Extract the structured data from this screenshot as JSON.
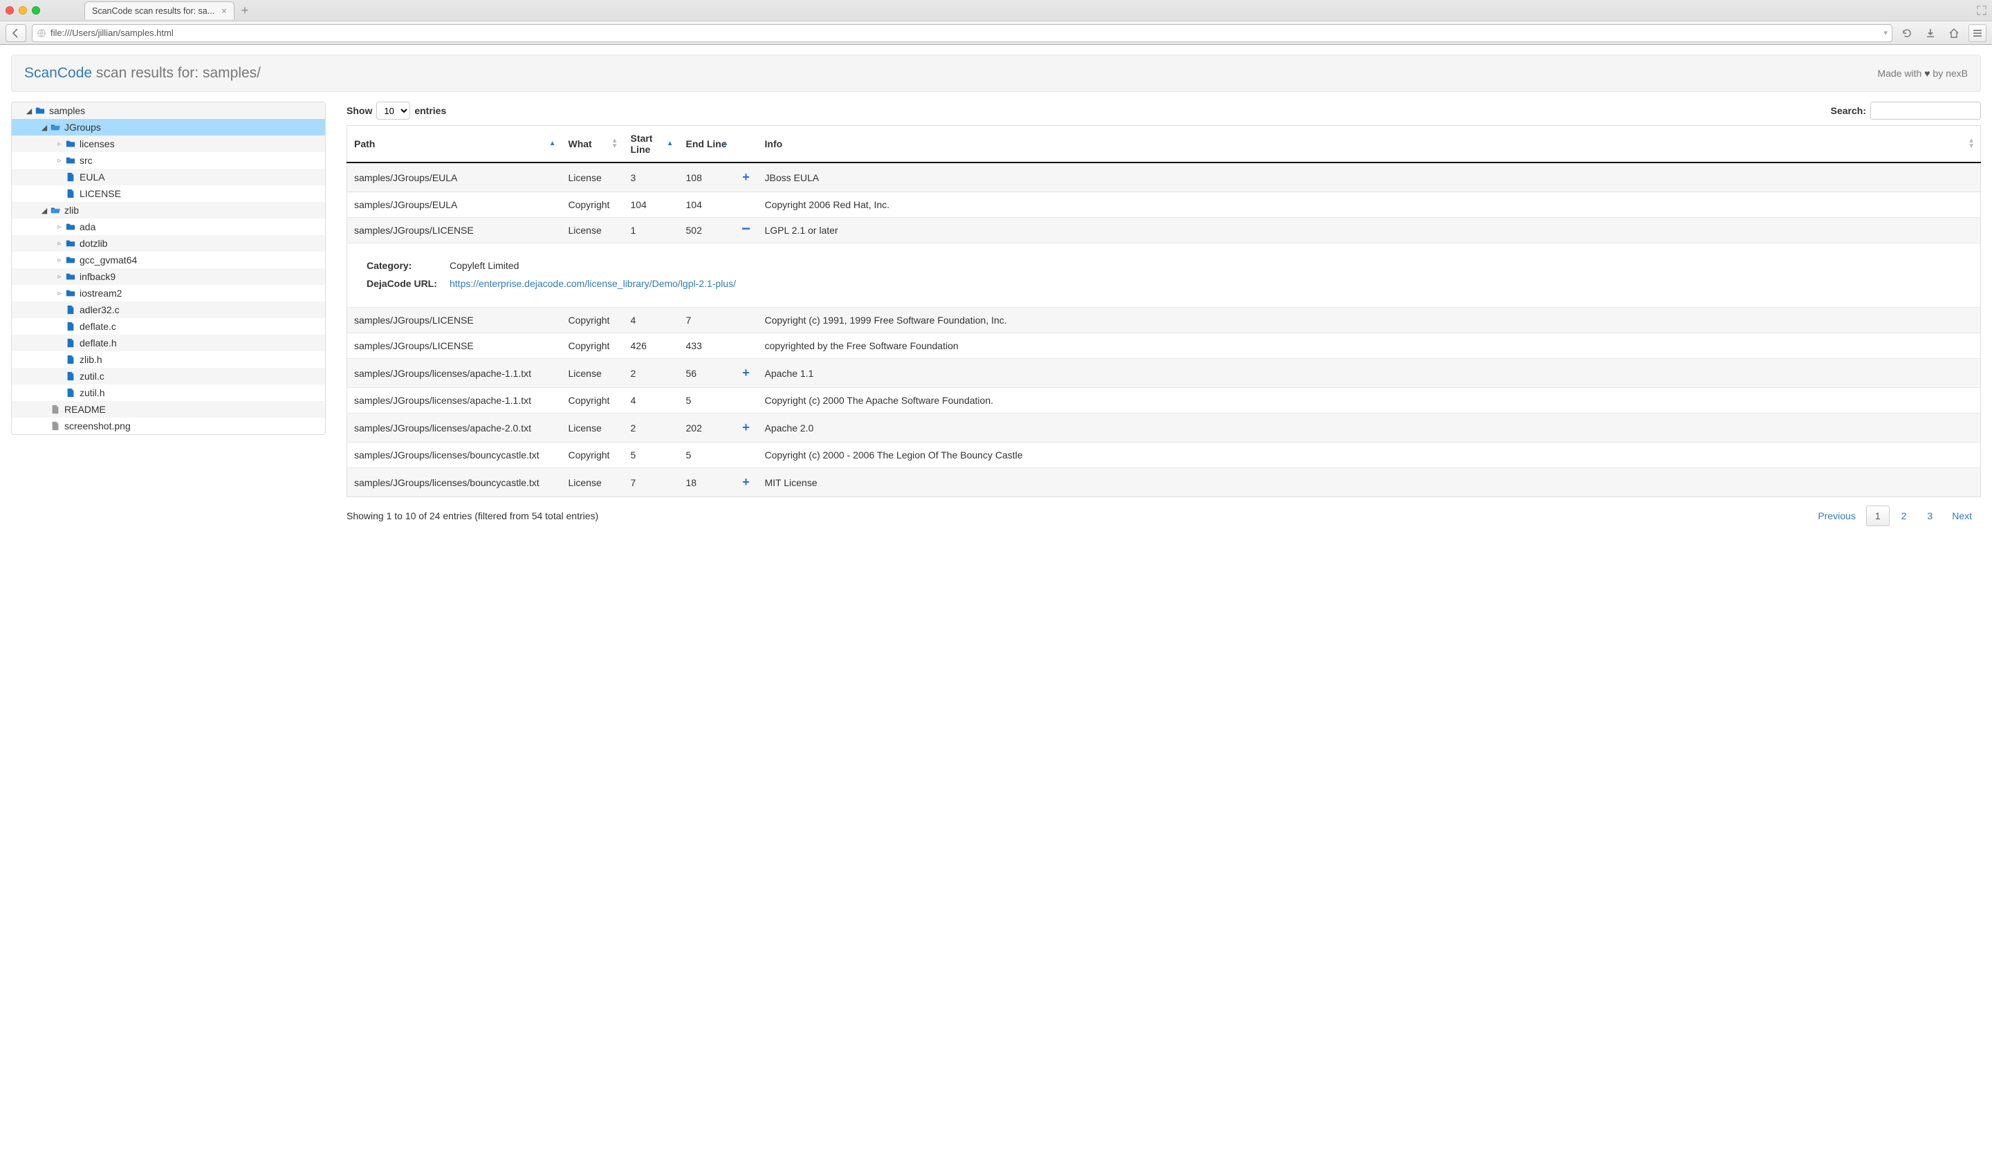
{
  "browser": {
    "tab_title": "ScanCode scan results for: sa...",
    "url": "file:///Users/jillian/samples.html"
  },
  "header": {
    "brand": "ScanCode",
    "title_rest": " scan results for: samples/",
    "made_with_prefix": "Made with ",
    "made_with_suffix": " by nexB",
    "heart": "♥"
  },
  "tree": [
    {
      "depth": 0,
      "toggle": "down",
      "icon": "folder",
      "label": "samples"
    },
    {
      "depth": 1,
      "toggle": "down",
      "icon": "folder-open",
      "label": "JGroups",
      "selected": true
    },
    {
      "depth": 2,
      "toggle": "right",
      "icon": "folder",
      "label": "licenses"
    },
    {
      "depth": 2,
      "toggle": "right",
      "icon": "folder",
      "label": "src"
    },
    {
      "depth": 2,
      "toggle": "none",
      "icon": "file",
      "label": "EULA"
    },
    {
      "depth": 2,
      "toggle": "none",
      "icon": "file",
      "label": "LICENSE"
    },
    {
      "depth": 1,
      "toggle": "down",
      "icon": "folder-open",
      "label": "zlib"
    },
    {
      "depth": 2,
      "toggle": "right",
      "icon": "folder",
      "label": "ada"
    },
    {
      "depth": 2,
      "toggle": "right",
      "icon": "folder",
      "label": "dotzlib"
    },
    {
      "depth": 2,
      "toggle": "right",
      "icon": "folder",
      "label": "gcc_gvmat64"
    },
    {
      "depth": 2,
      "toggle": "right",
      "icon": "folder",
      "label": "infback9"
    },
    {
      "depth": 2,
      "toggle": "right",
      "icon": "folder",
      "label": "iostream2"
    },
    {
      "depth": 2,
      "toggle": "none",
      "icon": "file",
      "label": "adler32.c"
    },
    {
      "depth": 2,
      "toggle": "none",
      "icon": "file",
      "label": "deflate.c"
    },
    {
      "depth": 2,
      "toggle": "none",
      "icon": "file",
      "label": "deflate.h"
    },
    {
      "depth": 2,
      "toggle": "none",
      "icon": "file",
      "label": "zlib.h"
    },
    {
      "depth": 2,
      "toggle": "none",
      "icon": "file",
      "label": "zutil.c"
    },
    {
      "depth": 2,
      "toggle": "none",
      "icon": "file",
      "label": "zutil.h"
    },
    {
      "depth": 1,
      "toggle": "none",
      "icon": "file-grey",
      "label": "README"
    },
    {
      "depth": 1,
      "toggle": "none",
      "icon": "file-grey",
      "label": "screenshot.png"
    }
  ],
  "table_controls": {
    "show_label": "Show",
    "entries_label": "entries",
    "page_size": "10",
    "search_label": "Search:",
    "search_value": ""
  },
  "columns": {
    "path": "Path",
    "what": "What",
    "start": "Start Line",
    "end": "End Line",
    "expand": "",
    "info": "Info"
  },
  "rows": [
    {
      "path": "samples/JGroups/EULA",
      "what": "License",
      "start": "3",
      "end": "108",
      "exp": "plus",
      "info": "JBoss EULA"
    },
    {
      "path": "samples/JGroups/EULA",
      "what": "Copyright",
      "start": "104",
      "end": "104",
      "exp": "",
      "info": "Copyright 2006 Red Hat, Inc."
    },
    {
      "path": "samples/JGroups/LICENSE",
      "what": "License",
      "start": "1",
      "end": "502",
      "exp": "minus",
      "info": "LGPL 2.1 or later"
    },
    {
      "detail": true,
      "category_label": "Category:",
      "category_value": "Copyleft Limited",
      "url_label": "DejaCode URL:",
      "url_value": "https://enterprise.dejacode.com/license_library/Demo/lgpl-2.1-plus/"
    },
    {
      "path": "samples/JGroups/LICENSE",
      "what": "Copyright",
      "start": "4",
      "end": "7",
      "exp": "",
      "info": "Copyright (c) 1991, 1999 Free Software Foundation, Inc."
    },
    {
      "path": "samples/JGroups/LICENSE",
      "what": "Copyright",
      "start": "426",
      "end": "433",
      "exp": "",
      "info": "copyrighted by the Free Software Foundation"
    },
    {
      "path": "samples/JGroups/licenses/apache-1.1.txt",
      "what": "License",
      "start": "2",
      "end": "56",
      "exp": "plus",
      "info": "Apache 1.1"
    },
    {
      "path": "samples/JGroups/licenses/apache-1.1.txt",
      "what": "Copyright",
      "start": "4",
      "end": "5",
      "exp": "",
      "info": "Copyright (c) 2000 The Apache Software Foundation."
    },
    {
      "path": "samples/JGroups/licenses/apache-2.0.txt",
      "what": "License",
      "start": "2",
      "end": "202",
      "exp": "plus",
      "info": "Apache 2.0"
    },
    {
      "path": "samples/JGroups/licenses/bouncycastle.txt",
      "what": "Copyright",
      "start": "5",
      "end": "5",
      "exp": "",
      "info": "Copyright (c) 2000 - 2006 The Legion Of The Bouncy Castle"
    },
    {
      "path": "samples/JGroups/licenses/bouncycastle.txt",
      "what": "License",
      "start": "7",
      "end": "18",
      "exp": "plus",
      "info": "MIT License"
    }
  ],
  "footer": {
    "info_text": "Showing 1 to 10 of 24 entries (filtered from 54 total entries)",
    "prev": "Previous",
    "next": "Next",
    "pages": [
      "1",
      "2",
      "3"
    ],
    "current_page": "1"
  }
}
